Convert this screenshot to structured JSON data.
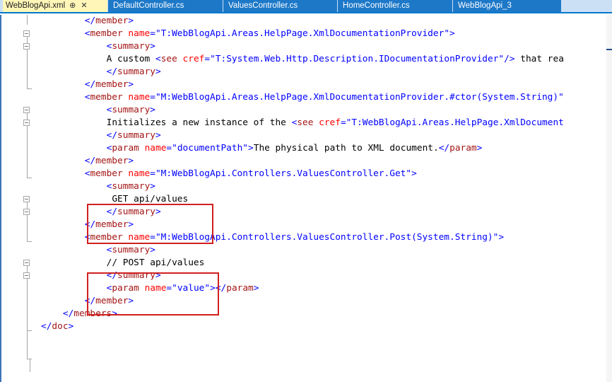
{
  "tabs": [
    {
      "label": "WebBlogApi.xml",
      "active": true,
      "pin": "⊕",
      "close": "✕"
    },
    {
      "label": "DefaultController.cs",
      "active": false
    },
    {
      "label": "ValuesController.cs",
      "active": false
    },
    {
      "label": "HomeController.cs",
      "active": false
    },
    {
      "label": "WebBlogApi_3",
      "active": false
    }
  ],
  "colors": {
    "tag": "#a31515",
    "delimiter": "#0000ff",
    "attribute": "#ff0000",
    "value": "#0000ff",
    "text": "#000000",
    "highlight": "#d02020",
    "tab_active_bg": "#fff6b8",
    "tab_bg": "#1d78c8"
  },
  "code": {
    "lines": [
      {
        "indent": 8,
        "segments": [
          [
            "d",
            "</"
          ],
          [
            "t",
            "member"
          ],
          [
            "d",
            ">"
          ]
        ]
      },
      {
        "indent": 8,
        "segments": [
          [
            "d",
            "<"
          ],
          [
            "t",
            "member"
          ],
          [
            "x",
            " "
          ],
          [
            "a",
            "name"
          ],
          [
            "d",
            "=\""
          ],
          [
            "v",
            "T:WebBlogApi.Areas.HelpPage.XmlDocumentationProvider"
          ],
          [
            "d",
            "\""
          ],
          [
            "d",
            ">"
          ]
        ]
      },
      {
        "indent": 12,
        "segments": [
          [
            "d",
            "<"
          ],
          [
            "t",
            "summary"
          ],
          [
            "d",
            ">"
          ]
        ]
      },
      {
        "indent": 12,
        "segments": [
          [
            "x",
            "A custom "
          ],
          [
            "d",
            "<"
          ],
          [
            "t",
            "see"
          ],
          [
            "x",
            " "
          ],
          [
            "a",
            "cref"
          ],
          [
            "d",
            "=\""
          ],
          [
            "v",
            "T:System.Web.Http.Description.IDocumentationProvider"
          ],
          [
            "d",
            "\""
          ],
          [
            "d",
            "/>"
          ],
          [
            "x",
            " that rea"
          ]
        ]
      },
      {
        "indent": 12,
        "segments": [
          [
            "d",
            "</"
          ],
          [
            "t",
            "summary"
          ],
          [
            "d",
            ">"
          ]
        ]
      },
      {
        "indent": 8,
        "segments": [
          [
            "d",
            "</"
          ],
          [
            "t",
            "member"
          ],
          [
            "d",
            ">"
          ]
        ]
      },
      {
        "indent": 8,
        "segments": [
          [
            "d",
            "<"
          ],
          [
            "t",
            "member"
          ],
          [
            "x",
            " "
          ],
          [
            "a",
            "name"
          ],
          [
            "d",
            "=\""
          ],
          [
            "v",
            "M:WebBlogApi.Areas.HelpPage.XmlDocumentationProvider.#ctor(System.String)"
          ],
          [
            "d",
            "\""
          ]
        ]
      },
      {
        "indent": 12,
        "segments": [
          [
            "d",
            "<"
          ],
          [
            "t",
            "summary"
          ],
          [
            "d",
            ">"
          ]
        ]
      },
      {
        "indent": 12,
        "segments": [
          [
            "x",
            "Initializes a new instance of the "
          ],
          [
            "d",
            "<"
          ],
          [
            "t",
            "see"
          ],
          [
            "x",
            " "
          ],
          [
            "a",
            "cref"
          ],
          [
            "d",
            "=\""
          ],
          [
            "v",
            "T:WebBlogApi.Areas.HelpPage.XmlDocument"
          ]
        ]
      },
      {
        "indent": 12,
        "segments": [
          [
            "d",
            "</"
          ],
          [
            "t",
            "summary"
          ],
          [
            "d",
            ">"
          ]
        ]
      },
      {
        "indent": 12,
        "segments": [
          [
            "d",
            "<"
          ],
          [
            "t",
            "param"
          ],
          [
            "x",
            " "
          ],
          [
            "a",
            "name"
          ],
          [
            "d",
            "=\""
          ],
          [
            "v",
            "documentPath"
          ],
          [
            "d",
            "\""
          ],
          [
            "d",
            ">"
          ],
          [
            "x",
            "The physical path to XML document."
          ],
          [
            "d",
            "</"
          ],
          [
            "t",
            "param"
          ],
          [
            "d",
            ">"
          ]
        ]
      },
      {
        "indent": 8,
        "segments": [
          [
            "d",
            "</"
          ],
          [
            "t",
            "member"
          ],
          [
            "d",
            ">"
          ]
        ]
      },
      {
        "indent": 8,
        "segments": [
          [
            "d",
            "<"
          ],
          [
            "t",
            "member"
          ],
          [
            "x",
            " "
          ],
          [
            "a",
            "name"
          ],
          [
            "d",
            "=\""
          ],
          [
            "v",
            "M:WebBlogApi.Controllers.ValuesController.Get"
          ],
          [
            "d",
            "\""
          ],
          [
            "d",
            ">"
          ]
        ]
      },
      {
        "indent": 12,
        "segments": [
          [
            "d",
            "<"
          ],
          [
            "t",
            "summary"
          ],
          [
            "d",
            ">"
          ]
        ]
      },
      {
        "indent": 12,
        "segments": [
          [
            "x",
            " GET api/values"
          ]
        ]
      },
      {
        "indent": 12,
        "segments": [
          [
            "d",
            "</"
          ],
          [
            "t",
            "summary"
          ],
          [
            "d",
            ">"
          ]
        ]
      },
      {
        "indent": 8,
        "segments": [
          [
            "d",
            "</"
          ],
          [
            "t",
            "member"
          ],
          [
            "d",
            ">"
          ]
        ]
      },
      {
        "indent": 8,
        "segments": [
          [
            "d",
            "<"
          ],
          [
            "t",
            "member"
          ],
          [
            "x",
            " "
          ],
          [
            "a",
            "name"
          ],
          [
            "d",
            "=\""
          ],
          [
            "v",
            "M:WebBlogApi.Controllers.ValuesController.Post(System.String)"
          ],
          [
            "d",
            "\""
          ],
          [
            "d",
            ">"
          ]
        ]
      },
      {
        "indent": 12,
        "segments": [
          [
            "d",
            "<"
          ],
          [
            "t",
            "summary"
          ],
          [
            "d",
            ">"
          ]
        ]
      },
      {
        "indent": 12,
        "segments": [
          [
            "x",
            "// POST api/values"
          ]
        ]
      },
      {
        "indent": 12,
        "segments": [
          [
            "d",
            "</"
          ],
          [
            "t",
            "summary"
          ],
          [
            "d",
            ">"
          ]
        ]
      },
      {
        "indent": 12,
        "segments": [
          [
            "d",
            "<"
          ],
          [
            "t",
            "param"
          ],
          [
            "x",
            " "
          ],
          [
            "a",
            "name"
          ],
          [
            "d",
            "=\""
          ],
          [
            "v",
            "value"
          ],
          [
            "d",
            "\""
          ],
          [
            "d",
            ">"
          ],
          [
            "d",
            "</"
          ],
          [
            "t",
            "param"
          ],
          [
            "d",
            ">"
          ]
        ]
      },
      {
        "indent": 8,
        "segments": [
          [
            "d",
            "</"
          ],
          [
            "t",
            "member"
          ],
          [
            "d",
            ">"
          ]
        ]
      },
      {
        "indent": 4,
        "segments": [
          [
            "d",
            "</"
          ],
          [
            "t",
            "members"
          ],
          [
            "d",
            ">"
          ]
        ]
      },
      {
        "indent": 0,
        "segments": [
          [
            "d",
            "</"
          ],
          [
            "t",
            "doc"
          ],
          [
            "d",
            ">"
          ]
        ]
      }
    ]
  }
}
